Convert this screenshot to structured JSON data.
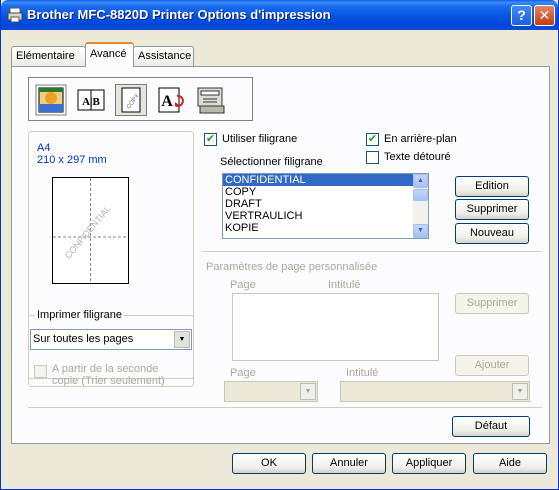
{
  "window": {
    "title": "Brother MFC-8820D Printer Options d'impression",
    "help_glyph": "?",
    "close_glyph": "✕"
  },
  "tabs": [
    {
      "label": "Elémentaire",
      "active": false
    },
    {
      "label": "Avancé",
      "active": true
    },
    {
      "label": "Assistance",
      "active": false
    }
  ],
  "toolbar": {
    "icons": [
      "color-icon",
      "duplex-icon",
      "watermark-icon",
      "page-setup-icon",
      "device-options-icon"
    ],
    "duplex_text": "A|B",
    "watermark_text": "COPY",
    "page_setup_text": "A"
  },
  "preview": {
    "paper_size": "A4",
    "paper_dims": "210 x 297 mm",
    "watermark_text": "CONFIDENTIAL"
  },
  "imprimer": {
    "group_label": "Imprimer filigrane",
    "selected": "Sur toutes les pages",
    "second_copy_label_line1": "A partir de la seconde",
    "second_copy_label_line2": "copie (Trier seulement)"
  },
  "watermark": {
    "use_label": "Utiliser filigrane",
    "use_checked": true,
    "background_label": "En arrière-plan",
    "background_checked": true,
    "outline_label": "Texte détouré",
    "outline_checked": false,
    "select_label": "Sélectionner filigrane",
    "items": [
      "CONFIDENTIAL",
      "COPY",
      "DRAFT",
      "VERTRAULICH",
      "KOPIE"
    ],
    "selected_index": 0,
    "edit_button": "Edition",
    "delete_button": "Supprimer",
    "new_button": "Nouveau"
  },
  "custom": {
    "section_label": "Paramètres de page personnalisée",
    "col_page": "Page",
    "col_title": "Intitulé",
    "delete_button": "Supprimer",
    "add_button": "Ajouter",
    "page_label": "Page",
    "title_label": "Intitulé"
  },
  "footer": {
    "default_button": "Défaut",
    "ok_button": "OK",
    "cancel_button": "Annuler",
    "apply_button": "Appliquer",
    "help_button": "Aide"
  },
  "colors": {
    "titlebar": "#0455e0",
    "selection": "#316ac5",
    "preview_text": "#0033cc"
  }
}
